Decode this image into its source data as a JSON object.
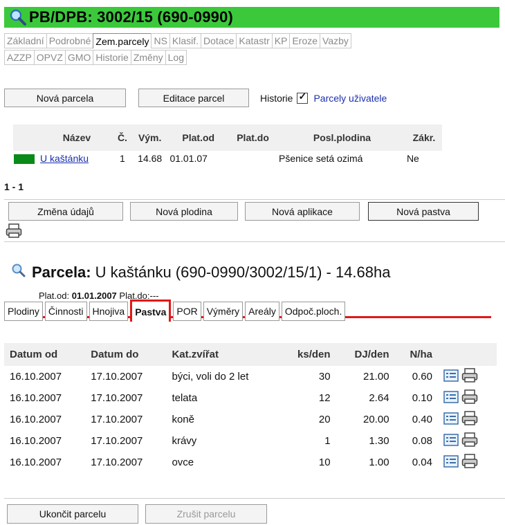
{
  "header": {
    "title": "PB/DPB: 3002/15 (690-0990)",
    "icon": "magnifier-icon"
  },
  "top_tabs": {
    "row1": [
      "Základní",
      "Podrobné",
      "Zem.parcely",
      "NS",
      "Klasif.",
      "Dotace",
      "Katastr",
      "KP",
      "Eroze",
      "Vazby"
    ],
    "row2": [
      "AZZP",
      "OPVZ",
      "GMO",
      "Historie",
      "Změny",
      "Log"
    ],
    "active": "Zem.parcely"
  },
  "toolbar": {
    "new_parcel": "Nová parcela",
    "edit_parcels": "Editace parcel",
    "history_label": "Historie",
    "history_checked": true,
    "user_parcels": "Parcely uživatele"
  },
  "parcels_table": {
    "headers": [
      "Název",
      "Č.",
      "Vým.",
      "Plat.od",
      "Plat.do",
      "Posl.plodina",
      "Zákr."
    ],
    "rows": [
      {
        "color": "#0a8a18",
        "name": "U kaštánku",
        "num": "1",
        "area": "14.68",
        "valid_from": "01.01.07",
        "valid_to": "",
        "last_crop": "Pšenice setá ozimá",
        "restriction": "Ne"
      }
    ]
  },
  "pagination": "1 - 1",
  "actions": {
    "change_data": "Změna údajů",
    "new_crop": "Nová plodina",
    "new_application": "Nová aplikace",
    "new_pasture": "Nová pastva"
  },
  "parcel": {
    "label": "Parcela:",
    "value": "U kaštánku (690-0990/3002/15/1) - 14.68ha",
    "plat_od_label": "Plat.od:",
    "plat_od": "01.01.2007",
    "plat_do_label": "Plat.do:",
    "plat_do": "---"
  },
  "parcel_tabs": {
    "items": [
      "Plodiny",
      "Činnosti",
      "Hnojiva",
      "Pastva",
      "POR",
      "Výměry",
      "Areály",
      "Odpoč.ploch."
    ],
    "active": "Pastva"
  },
  "pasture_table": {
    "headers": [
      "Datum od",
      "Datum do",
      "Kat.zvířat",
      "ks/den",
      "DJ/den",
      "N/ha"
    ],
    "rows": [
      {
        "from": "16.10.2007",
        "to": "17.10.2007",
        "category": "býci, voli do 2 let",
        "ks": "30",
        "dj": "21.00",
        "nha": "0.60"
      },
      {
        "from": "16.10.2007",
        "to": "17.10.2007",
        "category": "telata",
        "ks": "12",
        "dj": "2.64",
        "nha": "0.10"
      },
      {
        "from": "16.10.2007",
        "to": "17.10.2007",
        "category": "koně",
        "ks": "20",
        "dj": "20.00",
        "nha": "0.40"
      },
      {
        "from": "16.10.2007",
        "to": "17.10.2007",
        "category": "krávy",
        "ks": "1",
        "dj": "1.30",
        "nha": "0.08"
      },
      {
        "from": "16.10.2007",
        "to": "17.10.2007",
        "category": "ovce",
        "ks": "10",
        "dj": "1.00",
        "nha": "0.04"
      }
    ]
  },
  "bottom": {
    "end_parcel": "Ukončit parcelu",
    "cancel_parcel": "Zrušit parcelu"
  },
  "colors": {
    "header_green": "#3bc93b",
    "active_tab_red": "#e01818",
    "link_blue": "#1a2fb0"
  }
}
